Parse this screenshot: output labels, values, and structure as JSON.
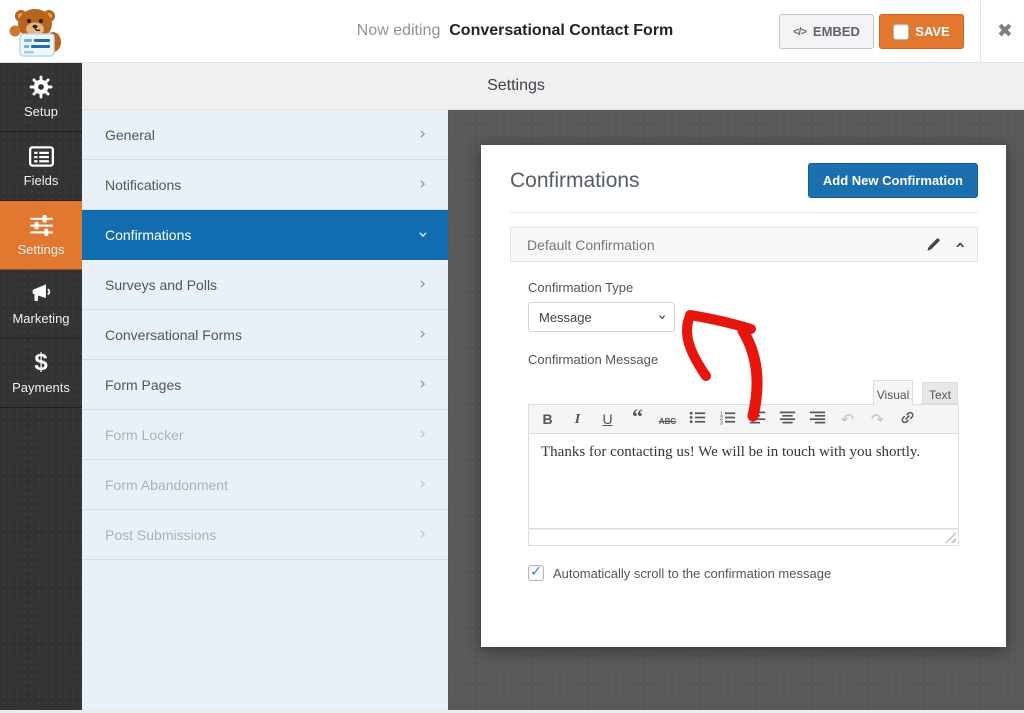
{
  "header": {
    "now_editing_prefix": "Now editing",
    "form_name": "Conversational Contact Form",
    "embed_icon": "</>",
    "embed_label": "EMBED",
    "save_icon": "✔",
    "save_label": "SAVE",
    "close_icon": "✖"
  },
  "sidebar": {
    "items": [
      {
        "id": "setup",
        "label": "Setup",
        "icon": "gear-icon",
        "active": false
      },
      {
        "id": "fields",
        "label": "Fields",
        "icon": "form-fields-icon",
        "active": false
      },
      {
        "id": "settings",
        "label": "Settings",
        "icon": "sliders-icon",
        "active": true
      },
      {
        "id": "marketing",
        "label": "Marketing",
        "icon": "megaphone-icon",
        "active": false
      },
      {
        "id": "payments",
        "label": "Payments",
        "icon": "dollar-icon",
        "active": false
      }
    ]
  },
  "topbar": {
    "title": "Settings"
  },
  "settings_nav": {
    "items": [
      {
        "label": "General",
        "state": "normal"
      },
      {
        "label": "Notifications",
        "state": "normal"
      },
      {
        "label": "Confirmations",
        "state": "active"
      },
      {
        "label": "Surveys and Polls",
        "state": "normal"
      },
      {
        "label": "Conversational Forms",
        "state": "normal"
      },
      {
        "label": "Form Pages",
        "state": "normal"
      },
      {
        "label": "Form Locker",
        "state": "disabled"
      },
      {
        "label": "Form Abandonment",
        "state": "disabled"
      },
      {
        "label": "Post Submissions",
        "state": "disabled"
      }
    ]
  },
  "content": {
    "title": "Confirmations",
    "add_button_label": "Add New Confirmation",
    "section_header": "Default Confirmation",
    "confirmation_type_label": "Confirmation Type",
    "confirmation_type_value": "Message",
    "confirmation_message_label": "Confirmation Message",
    "tabs": {
      "visual": "Visual",
      "text": "Text"
    },
    "editor_toolbar": [
      {
        "name": "bold",
        "disabled": false
      },
      {
        "name": "italic",
        "disabled": false
      },
      {
        "name": "underline",
        "disabled": false
      },
      {
        "name": "blockquote",
        "disabled": false
      },
      {
        "name": "strikethrough",
        "disabled": false
      },
      {
        "name": "bullet-list",
        "disabled": false
      },
      {
        "name": "numbered-list",
        "disabled": false
      },
      {
        "name": "align-left",
        "disabled": false
      },
      {
        "name": "align-center",
        "disabled": false
      },
      {
        "name": "align-right",
        "disabled": false
      },
      {
        "name": "undo",
        "disabled": true
      },
      {
        "name": "redo",
        "disabled": true
      },
      {
        "name": "link",
        "disabled": false
      }
    ],
    "editor_text": "Thanks for contacting us! We will be in touch with you shortly.",
    "checkbox_label": "Automatically scroll to the confirmation message",
    "checkbox_checked": "✓"
  },
  "colors": {
    "accent_orange": "#e27730",
    "accent_blue": "#116cb0",
    "check_blue": "#1e8cbe",
    "annotation_red": "#e8150c"
  }
}
